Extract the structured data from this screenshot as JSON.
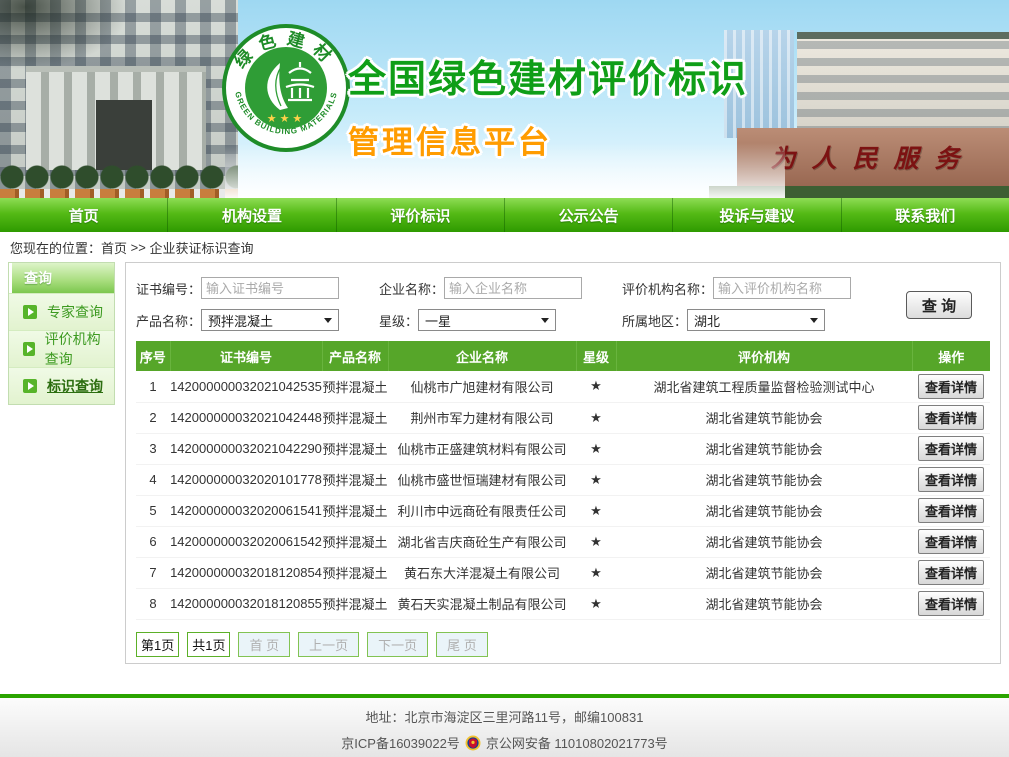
{
  "colors": {
    "nav_green_top": "#8edd55",
    "nav_green_bottom": "#2e9a00",
    "table_header_green": "#56a629",
    "title_green": "#0f9e17",
    "subtitle_orange": "#ff9c00",
    "footer_line_green": "#2ba400"
  },
  "header": {
    "title": "全国绿色建材评价标识",
    "subtitle": "管理信息平台",
    "logo": {
      "top_text": "绿色建材",
      "bottom_text": "GREEN BUILDING MATERIALS",
      "stars": "★ ★ ★"
    },
    "wall_text": "为人民服务"
  },
  "nav": {
    "items": [
      {
        "label": "首页"
      },
      {
        "label": "机构设置"
      },
      {
        "label": "评价标识"
      },
      {
        "label": "公示公告"
      },
      {
        "label": "投诉与建议"
      },
      {
        "label": "联系我们"
      }
    ]
  },
  "breadcrumb": {
    "prefix": "您现在的位置：",
    "home": "首页",
    "separator": " >> ",
    "current": "企业获证标识查询"
  },
  "sidebar": {
    "title": "查询",
    "items": [
      {
        "label": "专家查询"
      },
      {
        "label": "评价机构查询"
      },
      {
        "label": "标识查询"
      }
    ]
  },
  "search": {
    "cert_label": "证书编号：",
    "cert_placeholder": "输入证书编号",
    "company_label": "企业名称：",
    "company_placeholder": "输入企业名称",
    "agency_label": "评价机构名称：",
    "agency_placeholder": "输入评价机构名称",
    "product_label": "产品名称：",
    "product_value": "预拌混凝土",
    "star_label": "星级：",
    "star_value": "一星",
    "region_label": "所属地区：",
    "region_value": "湖北",
    "button_label": "查 询"
  },
  "table": {
    "headers": [
      "序号",
      "证书编号",
      "产品名称",
      "企业名称",
      "星级",
      "评价机构",
      "操作"
    ],
    "action_label": "查看详情",
    "rows": [
      {
        "no": "1",
        "cert": "142000000032021042535",
        "product": "预拌混凝土",
        "company": "仙桃市广旭建材有限公司",
        "star": "★",
        "agency": "湖北省建筑工程质量监督检验测试中心"
      },
      {
        "no": "2",
        "cert": "142000000032021042448",
        "product": "预拌混凝土",
        "company": "荆州市军力建材有限公司",
        "star": "★",
        "agency": "湖北省建筑节能协会"
      },
      {
        "no": "3",
        "cert": "142000000032021042290",
        "product": "预拌混凝土",
        "company": "仙桃市正盛建筑材料有限公司",
        "star": "★",
        "agency": "湖北省建筑节能协会"
      },
      {
        "no": "4",
        "cert": "142000000032020101778",
        "product": "预拌混凝土",
        "company": "仙桃市盛世恒瑞建材有限公司",
        "star": "★",
        "agency": "湖北省建筑节能协会"
      },
      {
        "no": "5",
        "cert": "142000000032020061541",
        "product": "预拌混凝土",
        "company": "利川市中远商砼有限责任公司",
        "star": "★",
        "agency": "湖北省建筑节能协会"
      },
      {
        "no": "6",
        "cert": "142000000032020061542",
        "product": "预拌混凝土",
        "company": "湖北省吉庆商砼生产有限公司",
        "star": "★",
        "agency": "湖北省建筑节能协会"
      },
      {
        "no": "7",
        "cert": "142000000032018120854",
        "product": "预拌混凝土",
        "company": "黄石东大洋混凝土有限公司",
        "star": "★",
        "agency": "湖北省建筑节能协会"
      },
      {
        "no": "8",
        "cert": "142000000032018120855",
        "product": "预拌混凝土",
        "company": "黄石天实混凝土制品有限公司",
        "star": "★",
        "agency": "湖北省建筑节能协会"
      }
    ]
  },
  "pagination": {
    "current": "第1页",
    "total": "共1页",
    "first": "首 页",
    "prev": "上一页",
    "next": "下一页",
    "last": "尾 页"
  },
  "footer": {
    "address": "地址：北京市海淀区三里河路11号，邮编100831",
    "icp": "京ICP备16039022号",
    "police": "京公网安备 11010802021773号"
  }
}
